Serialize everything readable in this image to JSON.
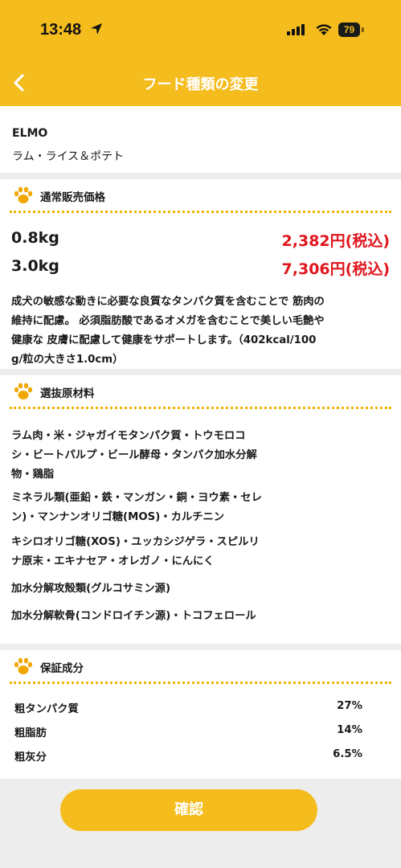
{
  "status_bar": {
    "time": "13:48",
    "battery": "79"
  },
  "nav": {
    "title": "フード種類の変更"
  },
  "product": {
    "brand": "ELMO",
    "name": "ラム・ライス＆ポテト"
  },
  "price_section": {
    "title": "通常販売価格",
    "rows": [
      {
        "weight": "0.8kg",
        "price": "2,382円(税込)"
      },
      {
        "weight": "3.0kg",
        "price": "7,306円(税込)"
      }
    ],
    "description_lines": [
      "成犬の敏感な動きに必要な良質なタンパク質を含むことで 筋肉の",
      "維持に配慮。 必須脂肪酸であるオメガを含むことで美しい毛艶や",
      "健康な 皮膚に配慮して健康をサポートします。（402kcal/100",
      "g/粒の大きさ1.0cm）"
    ]
  },
  "ingredients_section": {
    "title": "選抜原材料",
    "groups": [
      [
        "ラム肉・米・ジャガイモタンパク質・トウモロコ",
        "シ・ビートパルプ・ビール酵母・タンパク加水分解",
        "物・鶏脂"
      ],
      [
        "ミネラル類(亜鉛・鉄・マンガン・銅・ヨウ素・セレ",
        "ン)・マンナンオリゴ糖(MOS)・カルチニン"
      ],
      [
        "キシロオリゴ糖(XOS)・ユッカシジゲラ・スピルリ",
        "ナ原末・エキナセア・オレガノ・にんにく"
      ],
      [
        "加水分解攻殻類(グルコサミン源)"
      ],
      [
        "加水分解軟骨(コンドロイチン源)・トコフェロール"
      ]
    ]
  },
  "guarantee_section": {
    "title": "保証成分",
    "rows": [
      {
        "name": "粗タンパク質",
        "value": "27%"
      },
      {
        "name": "粗脂肪",
        "value": "14%"
      },
      {
        "name": "粗灰分",
        "value": "6.5%"
      }
    ]
  },
  "confirm_button": {
    "label": "確認"
  },
  "colors": {
    "accent": "#f4bc1c",
    "price_red": "#e0161d",
    "background": "#ededed"
  }
}
